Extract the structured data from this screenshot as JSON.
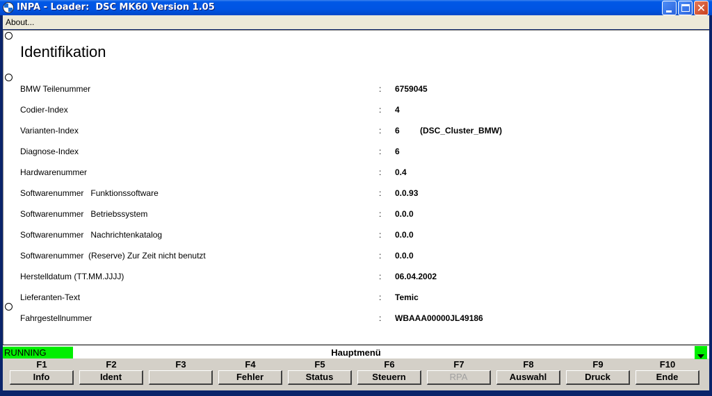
{
  "window": {
    "title": "INPA - Loader:  DSC MK60 Version 1.05",
    "close_glyph": "✕"
  },
  "menu": {
    "about": "About..."
  },
  "page": {
    "heading": "Identifikation",
    "rows": [
      {
        "label": "BMW Teilenummer",
        "value": "6759045",
        "extra": ""
      },
      {
        "label": "Codier-Index",
        "value": "4",
        "extra": ""
      },
      {
        "label": "Varianten-Index",
        "value": "6",
        "extra": "(DSC_Cluster_BMW)"
      },
      {
        "label": "Diagnose-Index",
        "value": "6",
        "extra": ""
      },
      {
        "label": "Hardwarenummer",
        "value": "0.4",
        "extra": ""
      },
      {
        "label": "Softwarenummer   Funktionssoftware",
        "value": "0.0.93",
        "extra": ""
      },
      {
        "label": "Softwarenummer   Betriebssystem",
        "value": "0.0.0",
        "extra": ""
      },
      {
        "label": "Softwarenummer   Nachrichtenkatalog",
        "value": "0.0.0",
        "extra": ""
      },
      {
        "label": "Softwarenummer  (Reserve) Zur Zeit nicht benutzt",
        "value": "0.0.0",
        "extra": ""
      },
      {
        "label": "Herstelldatum (TT.MM.JJJJ)",
        "value": "06.04.2002",
        "extra": ""
      },
      {
        "label": "Lieferanten-Text",
        "value": "Temic",
        "extra": ""
      },
      {
        "label": "Fahrgestellnummer",
        "value": "WBAAA00000JL49186",
        "extra": ""
      }
    ],
    "colon": ":"
  },
  "status": {
    "running": "RUNNING",
    "menu_title": "Hauptmenü"
  },
  "fkeys": [
    {
      "key": "F1",
      "label": "Info",
      "enabled": true
    },
    {
      "key": "F2",
      "label": "Ident",
      "enabled": true
    },
    {
      "key": "F3",
      "label": "",
      "enabled": true
    },
    {
      "key": "F4",
      "label": "Fehler",
      "enabled": true
    },
    {
      "key": "F5",
      "label": "Status",
      "enabled": true
    },
    {
      "key": "F6",
      "label": "Steuern",
      "enabled": true
    },
    {
      "key": "F7",
      "label": "RPA",
      "enabled": false
    },
    {
      "key": "F8",
      "label": "Auswahl",
      "enabled": true
    },
    {
      "key": "F9",
      "label": "Druck",
      "enabled": true
    },
    {
      "key": "F10",
      "label": "Ende",
      "enabled": true
    }
  ],
  "colors": {
    "running_green": "#00ee00",
    "titlebar_blue": "#0054e3",
    "disabled_text": "#a0a0a0"
  },
  "icons": {
    "app": "bmw-logo-icon",
    "minimize": "minimize-icon",
    "maximize": "maximize-icon",
    "close": "close-icon"
  }
}
